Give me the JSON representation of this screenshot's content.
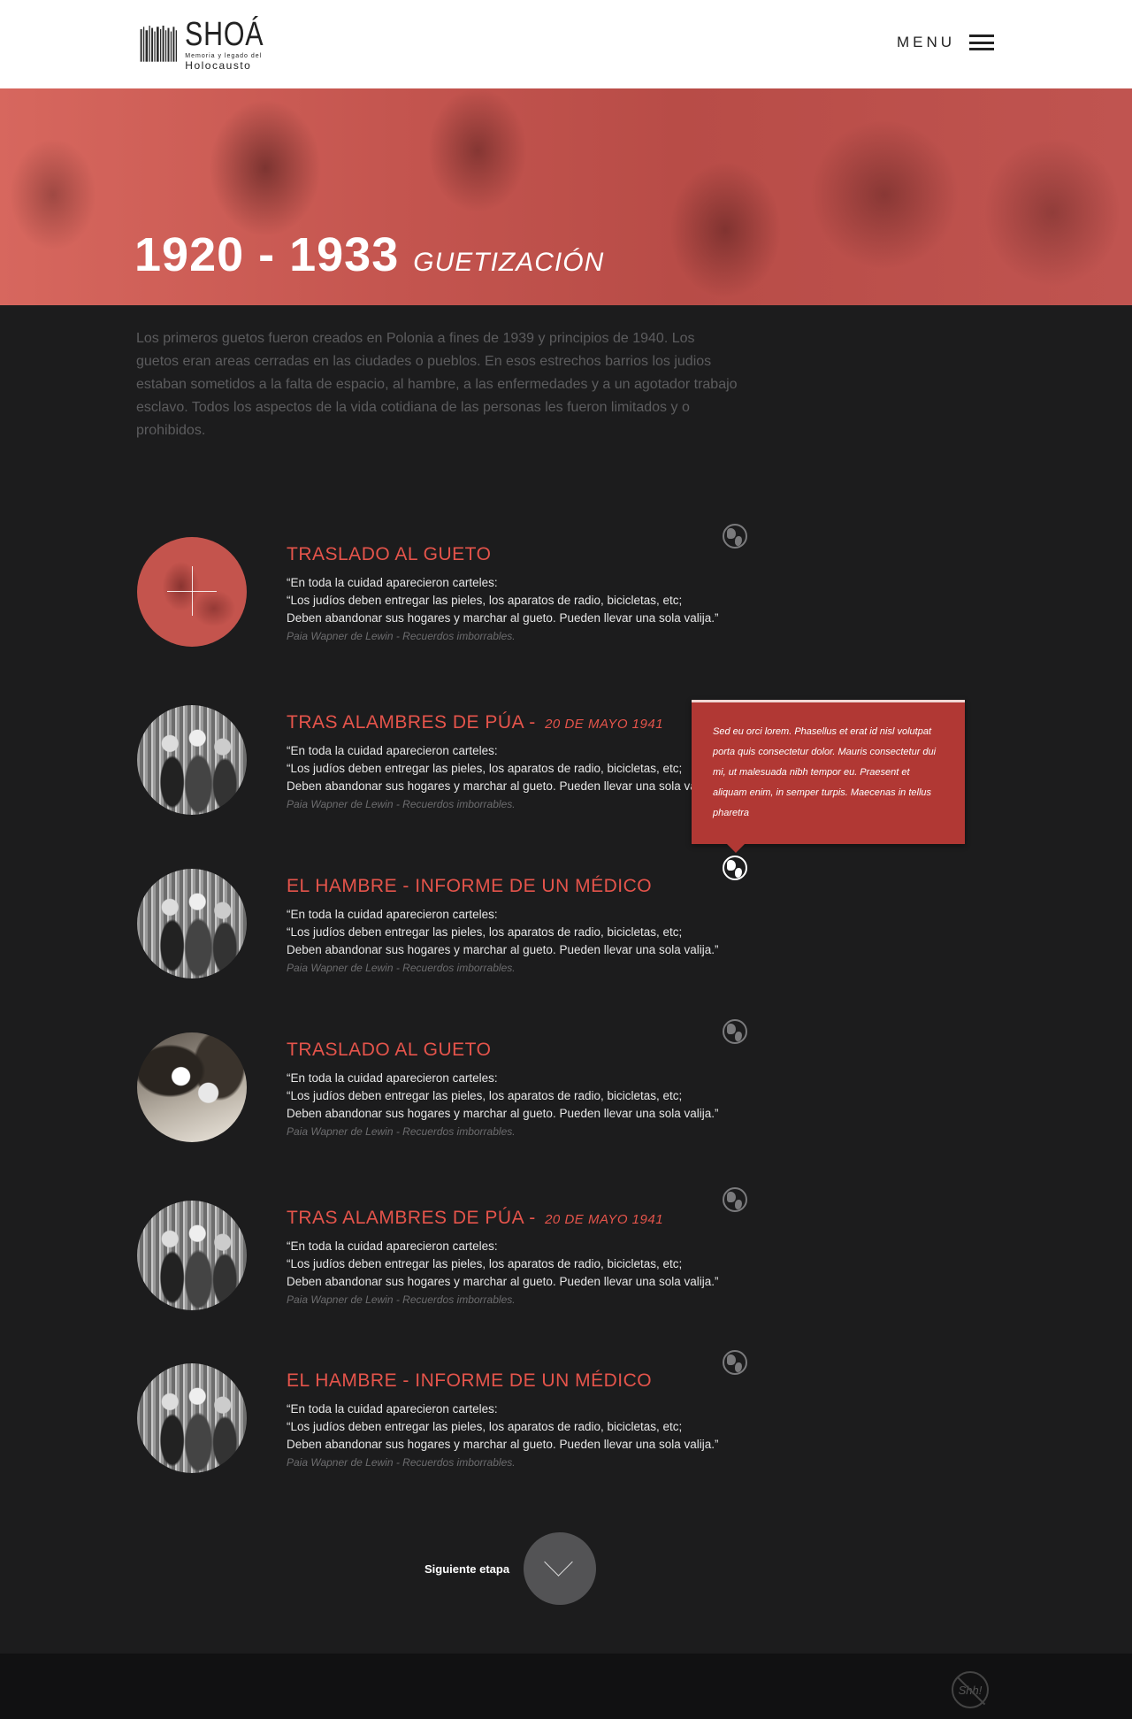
{
  "header": {
    "logo_title": "SHOÁ",
    "logo_sub1": "Memoria y legado del",
    "logo_sub2": "Holocausto",
    "menu_label": "MENU"
  },
  "hero": {
    "years": "1920 - 1933",
    "subtitle": "GUETIZACIÓN"
  },
  "intro": "Los primeros guetos fueron creados en Polonia a fines de 1939 y principios de 1940. Los guetos eran areas cerradas en las ciudades o pueblos. En esos estrechos barrios los judios estaban sometidos a la falta de espacio, al hambre, a las enfermedades y a un agotador trabajo esclavo. Todos los aspectos de la vida cotidiana de las personas les fueron limitados y o prohibidos.",
  "items": [
    {
      "title": "TRASLADO AL GUETO",
      "date": "",
      "quote": [
        "“En toda la cuidad aparecieron carteles:",
        "“Los judíos deben entregar las pieles, los aparatos de radio, bicicletas, etc;",
        "Deben abandonar sus hogares y marchar al gueto. Pueden llevar una sola valija.”"
      ],
      "credit": "Paia Wapner de Lewin - Recuerdos imborrables."
    },
    {
      "title": "TRAS ALAMBRES DE PÚA - ",
      "date": "20 DE MAYO 1941",
      "quote": [
        "“En toda la cuidad aparecieron carteles:",
        "“Los judíos deben entregar las pieles, los aparatos de radio, bicicletas, etc;",
        "Deben abandonar sus hogares y marchar al gueto. Pueden llevar una sola valija.”"
      ],
      "credit": "Paia Wapner de Lewin - Recuerdos imborrables."
    },
    {
      "title": "EL HAMBRE - INFORME DE UN MÉDICO",
      "date": "",
      "quote": [
        "“En toda la cuidad aparecieron carteles:",
        "“Los judíos deben entregar las pieles, los aparatos de radio, bicicletas, etc;",
        "Deben abandonar sus hogares y marchar al gueto. Pueden llevar una sola valija.”"
      ],
      "credit": "Paia Wapner de Lewin - Recuerdos imborrables."
    },
    {
      "title": "TRASLADO AL GUETO",
      "date": "",
      "quote": [
        "“En toda la cuidad aparecieron carteles:",
        "“Los judíos deben entregar las pieles, los aparatos de radio, bicicletas, etc;",
        "Deben abandonar sus hogares y marchar al gueto. Pueden llevar una sola valija.”"
      ],
      "credit": "Paia Wapner de Lewin - Recuerdos imborrables."
    },
    {
      "title": "TRAS ALAMBRES DE PÚA - ",
      "date": "20 DE MAYO 1941",
      "quote": [
        "“En toda la cuidad aparecieron carteles:",
        "“Los judíos deben entregar las pieles, los aparatos de radio, bicicletas, etc;",
        "Deben abandonar sus hogares y marchar al gueto. Pueden llevar una sola valija.”"
      ],
      "credit": "Paia Wapner de Lewin - Recuerdos imborrables."
    },
    {
      "title": "EL HAMBRE - INFORME DE UN MÉDICO",
      "date": "",
      "quote": [
        "“En toda la cuidad aparecieron carteles:",
        "“Los judíos deben entregar las pieles, los aparatos de radio, bicicletas, etc;",
        "Deben abandonar sus hogares y marchar al gueto. Pueden llevar una sola valija.”"
      ],
      "credit": "Paia Wapner de Lewin - Recuerdos imborrables."
    }
  ],
  "tooltip": {
    "text": "Sed eu orci lorem. Phasellus et erat id nisl volutpat porta quis consectetur dolor. Mauris consectetur dui mi, ut malesuada nibh tempor eu. Praesent et aliquam enim, in semper turpis. Maecenas in tellus pharetra"
  },
  "next": {
    "label": "Siguiente etapa"
  },
  "footer": {
    "badge": "Shh!"
  },
  "colors": {
    "accent": "#e5544b",
    "hero_red": "#c4554f",
    "background": "#1c1c1d",
    "tooltip": "#b13834"
  }
}
